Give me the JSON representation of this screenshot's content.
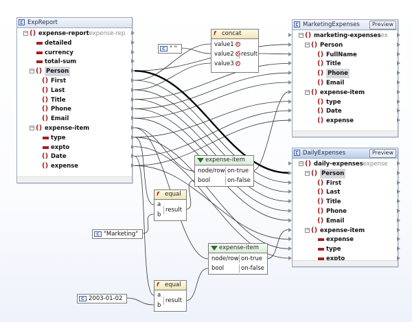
{
  "source_panel": {
    "title": "ExpReport",
    "rows": [
      {
        "label": "expense-report",
        "suffix": "expense-rep",
        "kind": "element",
        "toggle": "-",
        "indent": 0
      },
      {
        "label": "detailed",
        "kind": "attribute",
        "indent": 1
      },
      {
        "label": "currency",
        "kind": "attribute",
        "indent": 1
      },
      {
        "label": "total-sum",
        "kind": "attribute",
        "indent": 1
      },
      {
        "label": "Person",
        "kind": "element",
        "toggle": "-",
        "indent": 1,
        "highlight": true
      },
      {
        "label": "First",
        "kind": "element",
        "indent": 2
      },
      {
        "label": "Last",
        "kind": "element",
        "indent": 2
      },
      {
        "label": "Title",
        "kind": "element",
        "indent": 2
      },
      {
        "label": "Phone",
        "kind": "element",
        "indent": 2
      },
      {
        "label": "Email",
        "kind": "element",
        "indent": 2
      },
      {
        "label": "expense-item",
        "kind": "element",
        "toggle": "-",
        "indent": 1
      },
      {
        "label": "type",
        "kind": "attribute",
        "indent": 2
      },
      {
        "label": "expto",
        "kind": "attribute",
        "indent": 2
      },
      {
        "label": "Date",
        "kind": "element",
        "indent": 2
      },
      {
        "label": "expense",
        "kind": "element",
        "indent": 2
      }
    ]
  },
  "marketing_panel": {
    "title": "MarketingExpenses",
    "preview_label": "Preview",
    "rows": [
      {
        "label": "marketing-expenses",
        "suffix": "ex",
        "kind": "element",
        "toggle": "-",
        "indent": 0
      },
      {
        "label": "Person",
        "kind": "element",
        "toggle": "-",
        "indent": 1
      },
      {
        "label": "FullName",
        "kind": "element",
        "indent": 2
      },
      {
        "label": "Title",
        "kind": "element",
        "indent": 2
      },
      {
        "label": "Phone",
        "kind": "element",
        "indent": 2,
        "highlight": true
      },
      {
        "label": "Email",
        "kind": "element",
        "indent": 2
      },
      {
        "label": "expense-item",
        "kind": "element",
        "toggle": "-",
        "indent": 1
      },
      {
        "label": "type",
        "kind": "element",
        "indent": 2
      },
      {
        "label": "Date",
        "kind": "element",
        "indent": 2
      },
      {
        "label": "expense",
        "kind": "element",
        "indent": 2
      }
    ]
  },
  "daily_panel": {
    "title": "DailyExpenses",
    "preview_label": "Preview",
    "rows": [
      {
        "label": "daily-expenses",
        "suffix": "expense",
        "kind": "element",
        "toggle": "-",
        "indent": 0
      },
      {
        "label": "Person",
        "kind": "element",
        "toggle": "-",
        "indent": 1,
        "highlight": true
      },
      {
        "label": "First",
        "kind": "element",
        "indent": 2
      },
      {
        "label": "Last",
        "kind": "element",
        "indent": 2
      },
      {
        "label": "Title",
        "kind": "element",
        "indent": 2
      },
      {
        "label": "Phone",
        "kind": "element",
        "indent": 2
      },
      {
        "label": "Email",
        "kind": "element",
        "indent": 2
      },
      {
        "label": "expense-item",
        "kind": "element",
        "toggle": "-",
        "indent": 1
      },
      {
        "label": "expense",
        "kind": "attribute",
        "indent": 2
      },
      {
        "label": "type",
        "kind": "attribute",
        "indent": 2
      },
      {
        "label": "expto",
        "kind": "attribute",
        "indent": 2
      }
    ]
  },
  "concat_fn": {
    "title": "concat",
    "inputs": [
      "value1",
      "value2",
      "value3"
    ],
    "output": "result"
  },
  "equal_fn_1": {
    "title": "equal",
    "inputs": [
      "a",
      "b"
    ],
    "output": "result"
  },
  "equal_fn_2": {
    "title": "equal",
    "inputs": [
      "a",
      "b"
    ],
    "output": "result"
  },
  "filter_1": {
    "title": "expense-item",
    "inputs": [
      "node/row",
      "bool"
    ],
    "outputs": [
      "on-true",
      "on-false"
    ]
  },
  "filter_2": {
    "title": "expense-item",
    "inputs": [
      "node/row",
      "bool"
    ],
    "outputs": [
      "on-true",
      "on-false"
    ]
  },
  "const_space": {
    "value": "\" \""
  },
  "const_marketing": {
    "value": "\"Marketing\""
  },
  "const_date": {
    "value": "2003-01-02"
  },
  "icons": {
    "schema": "schema-icon",
    "element": "element-icon",
    "attribute": "attribute-icon",
    "function": "function-icon",
    "filter": "filter-icon",
    "constant": "constant-icon"
  },
  "colors": {
    "element_icon": "#a12020",
    "panel_border": "#9aa7bd",
    "title_blue": "#b9ccea",
    "wire": "#333333",
    "selected_wire": "#000000"
  }
}
